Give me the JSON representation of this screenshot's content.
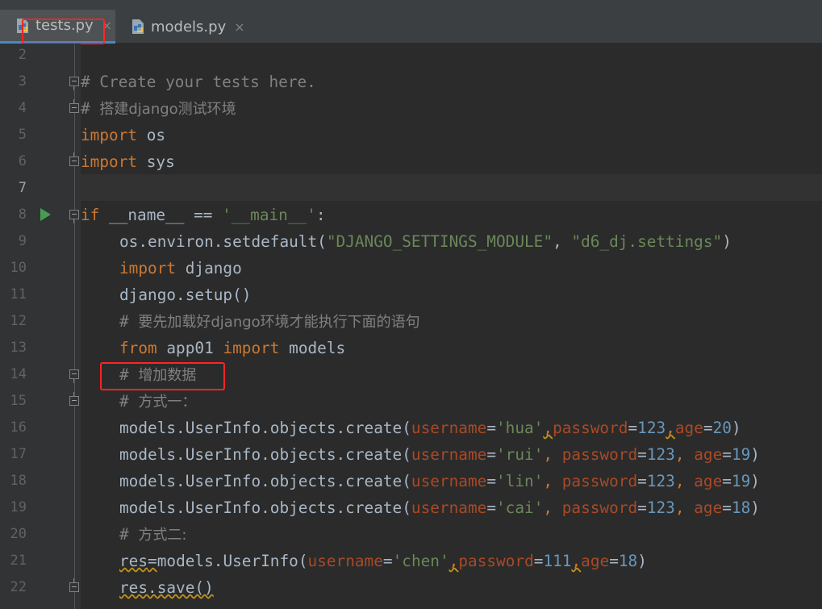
{
  "tabs": [
    {
      "label": "tests.py",
      "active": true,
      "close": "×"
    },
    {
      "label": "models.py",
      "active": false,
      "close": "×"
    }
  ],
  "colors": {
    "background": "#2b2b2b",
    "keyword": "#cc7832",
    "comment": "#808080",
    "string": "#6a8759",
    "number": "#6897bb",
    "kwarg": "#aa4926",
    "highlight_box": "#ff2424",
    "run_icon": "#499c54"
  },
  "icons": {
    "tab_file": "python-file-icon",
    "run": "run-gutter-icon"
  },
  "current_line": 7,
  "lines": [
    {
      "n": "2"
    },
    {
      "n": "3",
      "t": {
        "a": "# Create your tests here."
      }
    },
    {
      "n": "4",
      "t": {
        "a": "# ",
        "b": "搭建",
        "c": "django",
        "d": "测试环境"
      }
    },
    {
      "n": "5",
      "t": {
        "a": "import",
        "b": " os"
      }
    },
    {
      "n": "6",
      "t": {
        "a": "import",
        "b": " sys"
      }
    },
    {
      "n": "7"
    },
    {
      "n": "8",
      "t": {
        "a": "if",
        "b": " __name__ == ",
        "c": "'__main__'",
        "d": ":"
      }
    },
    {
      "n": "9",
      "t": {
        "a": "os.environ.setdefault(",
        "b": "\"DJANGO_SETTINGS_MODULE\"",
        "c": ", ",
        "d": "\"d6_dj.settings\"",
        "e": ")"
      }
    },
    {
      "n": "10",
      "t": {
        "a": "import",
        "b": " django"
      }
    },
    {
      "n": "11",
      "t": {
        "a": "django.setup()"
      }
    },
    {
      "n": "12",
      "t": {
        "a": "# ",
        "b": "要先加载好",
        "c": "django",
        "d": "环境才能执行下面的语句"
      }
    },
    {
      "n": "13",
      "t": {
        "a": "from",
        "b": " app01 ",
        "c": "import",
        "d": " models"
      }
    },
    {
      "n": "14",
      "t": {
        "a": "# ",
        "b": "增加数据"
      }
    },
    {
      "n": "15",
      "t": {
        "a": "# ",
        "b": "方式一："
      }
    },
    {
      "n": "16",
      "t": {
        "a": "models.UserInfo.objects.create(",
        "b": "username",
        "c": "=",
        "d": "'hua'",
        "e": ",",
        "f": "password",
        "g": "=",
        "h": "123",
        "i": ",",
        "j": "age",
        "k": "=",
        "l": "20",
        "m": ")"
      }
    },
    {
      "n": "17",
      "t": {
        "a": "models.UserInfo.objects.create(",
        "b": "username",
        "c": "=",
        "d": "'rui'",
        "e": ", ",
        "f": "password",
        "g": "=",
        "h": "123",
        "i": ", ",
        "j": "age",
        "k": "=",
        "l": "19",
        "m": ")"
      }
    },
    {
      "n": "18",
      "t": {
        "a": "models.UserInfo.objects.create(",
        "b": "username",
        "c": "=",
        "d": "'lin'",
        "e": ", ",
        "f": "password",
        "g": "=",
        "h": "123",
        "i": ", ",
        "j": "age",
        "k": "=",
        "l": "19",
        "m": ")"
      }
    },
    {
      "n": "19",
      "t": {
        "a": "models.UserInfo.objects.create(",
        "b": "username",
        "c": "=",
        "d": "'cai'",
        "e": ", ",
        "f": "password",
        "g": "=",
        "h": "123",
        "i": ", ",
        "j": "age",
        "k": "=",
        "l": "18",
        "m": ")"
      }
    },
    {
      "n": "20",
      "t": {
        "a": "# ",
        "b": "方式二:"
      }
    },
    {
      "n": "21",
      "t": {
        "a": "res",
        "b": "=",
        "c": "models.UserInfo(",
        "d": "username",
        "e": "=",
        "f": "'chen'",
        "g": ",",
        "h": "password",
        "i": "=",
        "j": "111",
        "k": ",",
        "l": "age",
        "m": "=",
        "n": "18",
        "o": ")"
      }
    },
    {
      "n": "22",
      "t": {
        "a": "res.save()"
      }
    }
  ]
}
